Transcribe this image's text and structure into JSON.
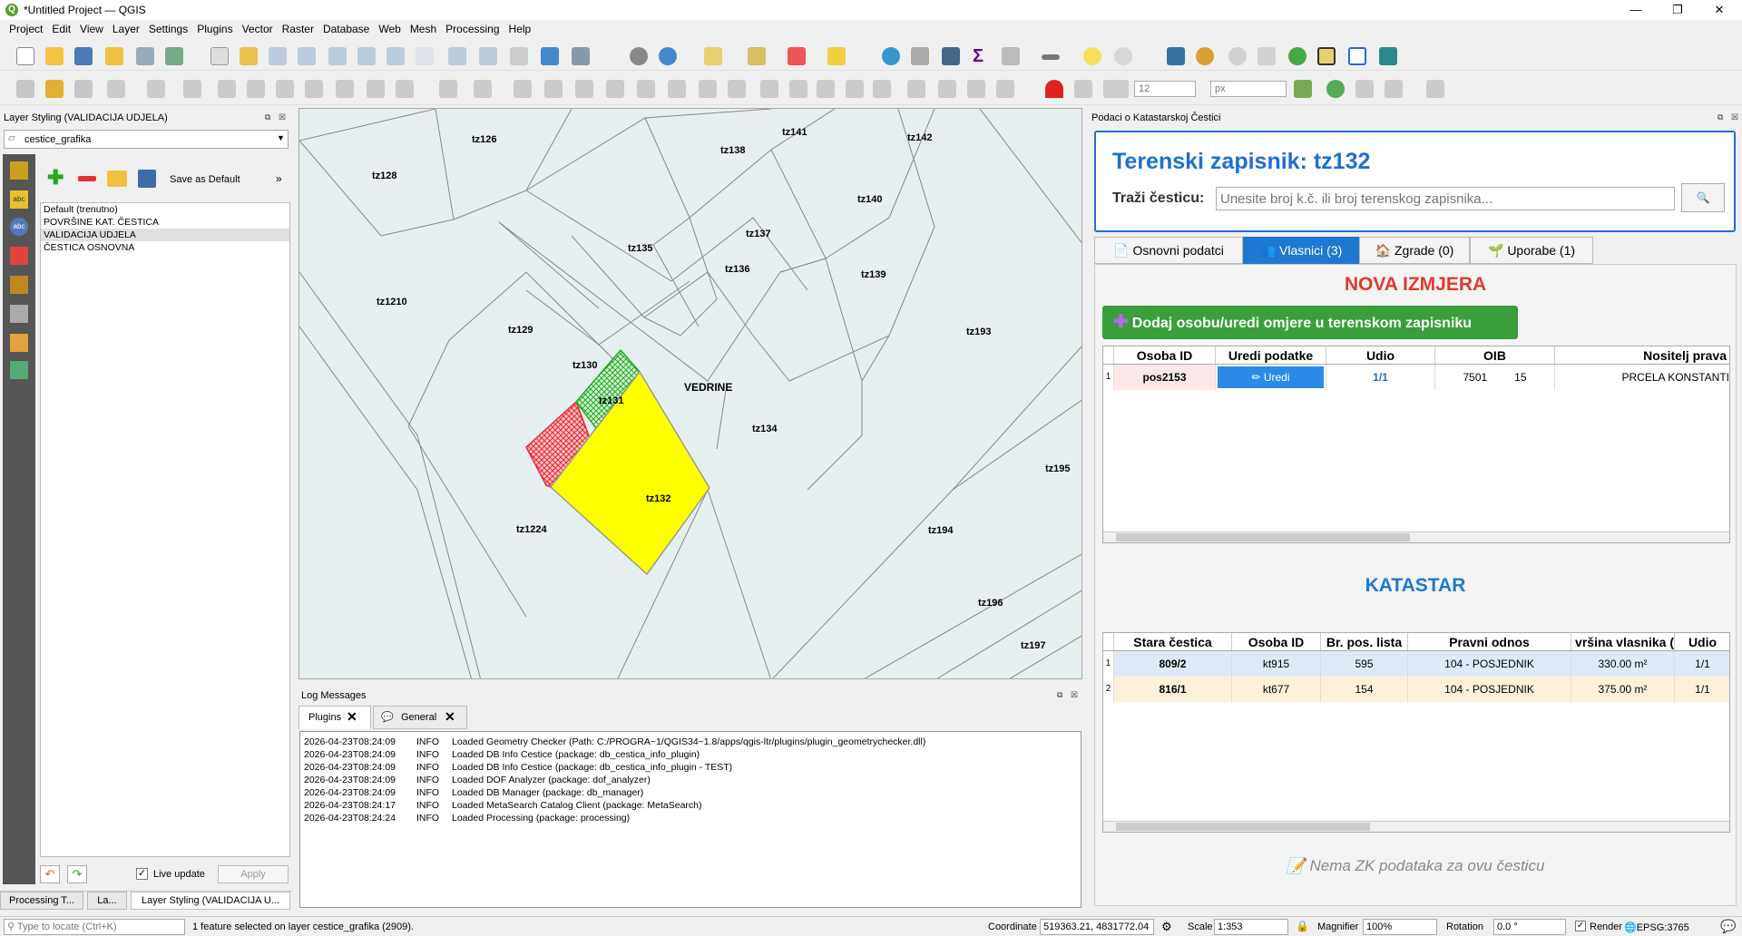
{
  "window": {
    "title": "*Untitled Project — QGIS",
    "min": "—",
    "max": "❐",
    "close": "✕"
  },
  "menu": [
    "Project",
    "Edit",
    "View",
    "Layer",
    "Settings",
    "Plugins",
    "Vector",
    "Raster",
    "Database",
    "Web",
    "Mesh",
    "Processing",
    "Help"
  ],
  "toolbar": {
    "spin_value": "12",
    "unit_value": "px"
  },
  "layer_styling": {
    "title": "Layer Styling (VALIDACIJA UDJELA)",
    "layer_select": "cestice_grafika",
    "save_default": "Save as Default",
    "styles": [
      "Default (trenutno)",
      "POVRŠINE KAT. ČESTICA",
      "VALIDACIJA UDJELA",
      "ČESTICA OSNOVNA"
    ],
    "selected_style_index": 2,
    "live_update": "Live update",
    "apply": "Apply",
    "bottom_tabs": [
      "Processing T...",
      "La...",
      "Layer Styling (VALIDACIJA U..."
    ]
  },
  "map": {
    "labels": [
      "tz126",
      "tz128",
      "tz138",
      "tz141",
      "tz142",
      "tz140",
      "tz137",
      "tz135",
      "tz136",
      "tz139",
      "tz1210",
      "tz129",
      "tz193",
      "tz130",
      "tz131",
      "VEDRINE",
      "tz134",
      "tz132",
      "tz195",
      "tz1224",
      "tz194",
      "tz196",
      "tz197"
    ]
  },
  "log": {
    "title": "Log Messages",
    "tabs": [
      "Plugins",
      "General"
    ],
    "rows": [
      {
        "time": "2026-04-23T08:24:09",
        "level": "INFO",
        "msg": "Loaded Geometry Checker (Path: C:/PROGRA~1/QGIS34~1.8/apps/qgis-ltr/plugins/plugin_geometrychecker.dll)"
      },
      {
        "time": "2026-04-23T08:24:09",
        "level": "INFO",
        "msg": "Loaded DB Info Cestice (package: db_cestica_info_plugin)"
      },
      {
        "time": "2026-04-23T08:24:09",
        "level": "INFO",
        "msg": "Loaded DB Info Cestice (package: db_cestica_info_plugin - TEST)"
      },
      {
        "time": "2026-04-23T08:24:09",
        "level": "INFO",
        "msg": "Loaded DOF Analyzer (package: dof_analyzer)"
      },
      {
        "time": "2026-04-23T08:24:09",
        "level": "INFO",
        "msg": "Loaded DB Manager (package: db_manager)"
      },
      {
        "time": "2026-04-23T08:24:17",
        "level": "INFO",
        "msg": "Loaded MetaSearch Catalog Client (package: MetaSearch)"
      },
      {
        "time": "2026-04-23T08:24:24",
        "level": "INFO",
        "msg": "Loaded Processing (package: processing)"
      }
    ]
  },
  "right": {
    "panel_title": "Podaci o Katastarskoj Čestici",
    "heading": "Terenski zapisnik: tz132",
    "search_label": "Traži česticu:",
    "search_placeholder": "Unesite broj k.č. ili broj terenskog zapisnika...",
    "search_button_icon": "🔍",
    "tabs": [
      {
        "icon": "📄",
        "label": "Osnovni podatci"
      },
      {
        "icon": "👥",
        "label": "Vlasnici (3)"
      },
      {
        "icon": "🏠",
        "label": "Zgrade (0)"
      },
      {
        "icon": "🌱",
        "label": "Uporabe (1)"
      }
    ],
    "active_tab": 1,
    "nova_izmjera": "NOVA IZMJERA",
    "add_button": "Dodaj osobu/uredi omjere u terenskom zapisniku",
    "owners_headers": [
      "Osoba ID",
      "Uredi podatke",
      "Udio",
      "OIB",
      "Nositelj prava"
    ],
    "owners_rows": [
      {
        "n": "1",
        "osoba": "pos2153",
        "uredi": "✏ Uredi",
        "udio": "1/1",
        "oib": "7501",
        "oib2": "15",
        "nositelj": "PRCELA KONSTANTI"
      }
    ],
    "katastar": "KATASTAR",
    "katastar_headers": [
      "Stara čestica",
      "Osoba ID",
      "Br. pos. lista",
      "Pravni odnos",
      "vršina vlasnika (",
      "Udio"
    ],
    "katastar_rows": [
      {
        "n": "1",
        "stara": "809/2",
        "osoba": "kt915",
        "br": "595",
        "pravni": "104 - POSJEDNIK",
        "povrsina": "330.00 m²",
        "udio": "1/1"
      },
      {
        "n": "2",
        "stara": "816/1",
        "osoba": "kt677",
        "br": "154",
        "pravni": "104 - POSJEDNIK",
        "povrsina": "375.00 m²",
        "udio": "1/1"
      }
    ],
    "zk_note": "Nema ZK podataka za ovu česticu"
  },
  "status": {
    "locate_placeholder": "Type to locate (Ctrl+K)",
    "message": "1 feature selected on layer cestice_grafika (2909).",
    "coord_label": "Coordinate",
    "coord_value": "519363.21, 4831772.04",
    "scale_label": "Scale",
    "scale_value": "1:353",
    "magnifier_label": "Magnifier",
    "magnifier_value": "100%",
    "rotation_label": "Rotation",
    "rotation_value": "0.0 °",
    "render_label": "Render",
    "epsg": "EPSG:3765"
  },
  "colors": {
    "accent": "#1e78d2",
    "red_heading": "#e03a2c",
    "green_button": "#3a9e3a",
    "parcel_yellow": "#ffff00",
    "selected_row": "#dfeaf8",
    "row2": "#fdf1dc"
  }
}
